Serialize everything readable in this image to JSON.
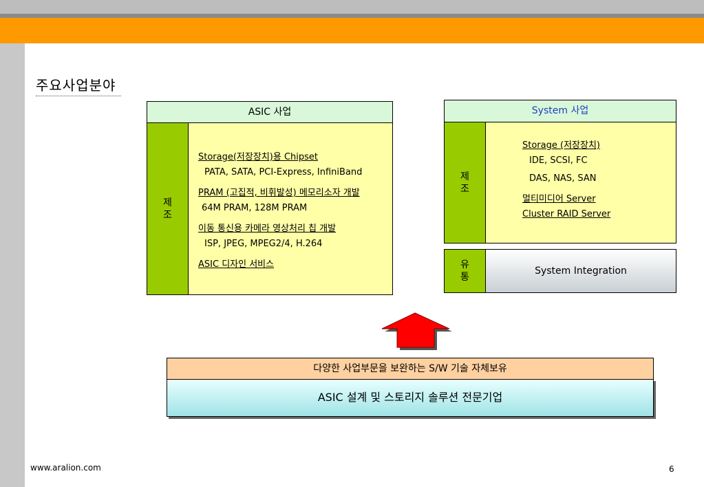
{
  "heading": "주요사업분야",
  "asic": {
    "header": "ASIC 사업",
    "side_label": [
      "제",
      "조"
    ],
    "lines": [
      "Storage(저장장치)용 Chipset",
      "PATA, SATA, PCI-Express, InfiniBand",
      "PRAM (고집적, 비휘발성) 메모리소자 개발",
      "64M PRAM, 128M PRAM",
      "이동 통신용 카메라 영상처리 칩 개발",
      "ISP, JPEG, MPEG2/4, H.264",
      "ASIC 디자인 서비스"
    ]
  },
  "system": {
    "header": "System 사업",
    "header_color": "#1f3fbf",
    "side_label": [
      "제",
      "조"
    ],
    "lines": [
      "Storage (저장장치)",
      "IDE, SCSI, FC",
      "DAS, NAS, SAN",
      "멀티미디어 Server",
      "Cluster RAID Server"
    ],
    "distribution_label": [
      "유",
      "통"
    ],
    "integration": "System Integration"
  },
  "bottom": {
    "sw_bar": "다양한 사업부문을 보완하는 S/W 기술 자체보유",
    "main_bar": "ASIC 설계 및 스토리지 솔루션 전문기업"
  },
  "footer": {
    "url": "www.aralion.com",
    "page": "6"
  },
  "colors": {
    "orange_band": "#ff9900",
    "green": "#99cc00",
    "yellow": "#ffffa8",
    "header_green": "#d9f7d9",
    "arrow_red": "#ff0000"
  }
}
